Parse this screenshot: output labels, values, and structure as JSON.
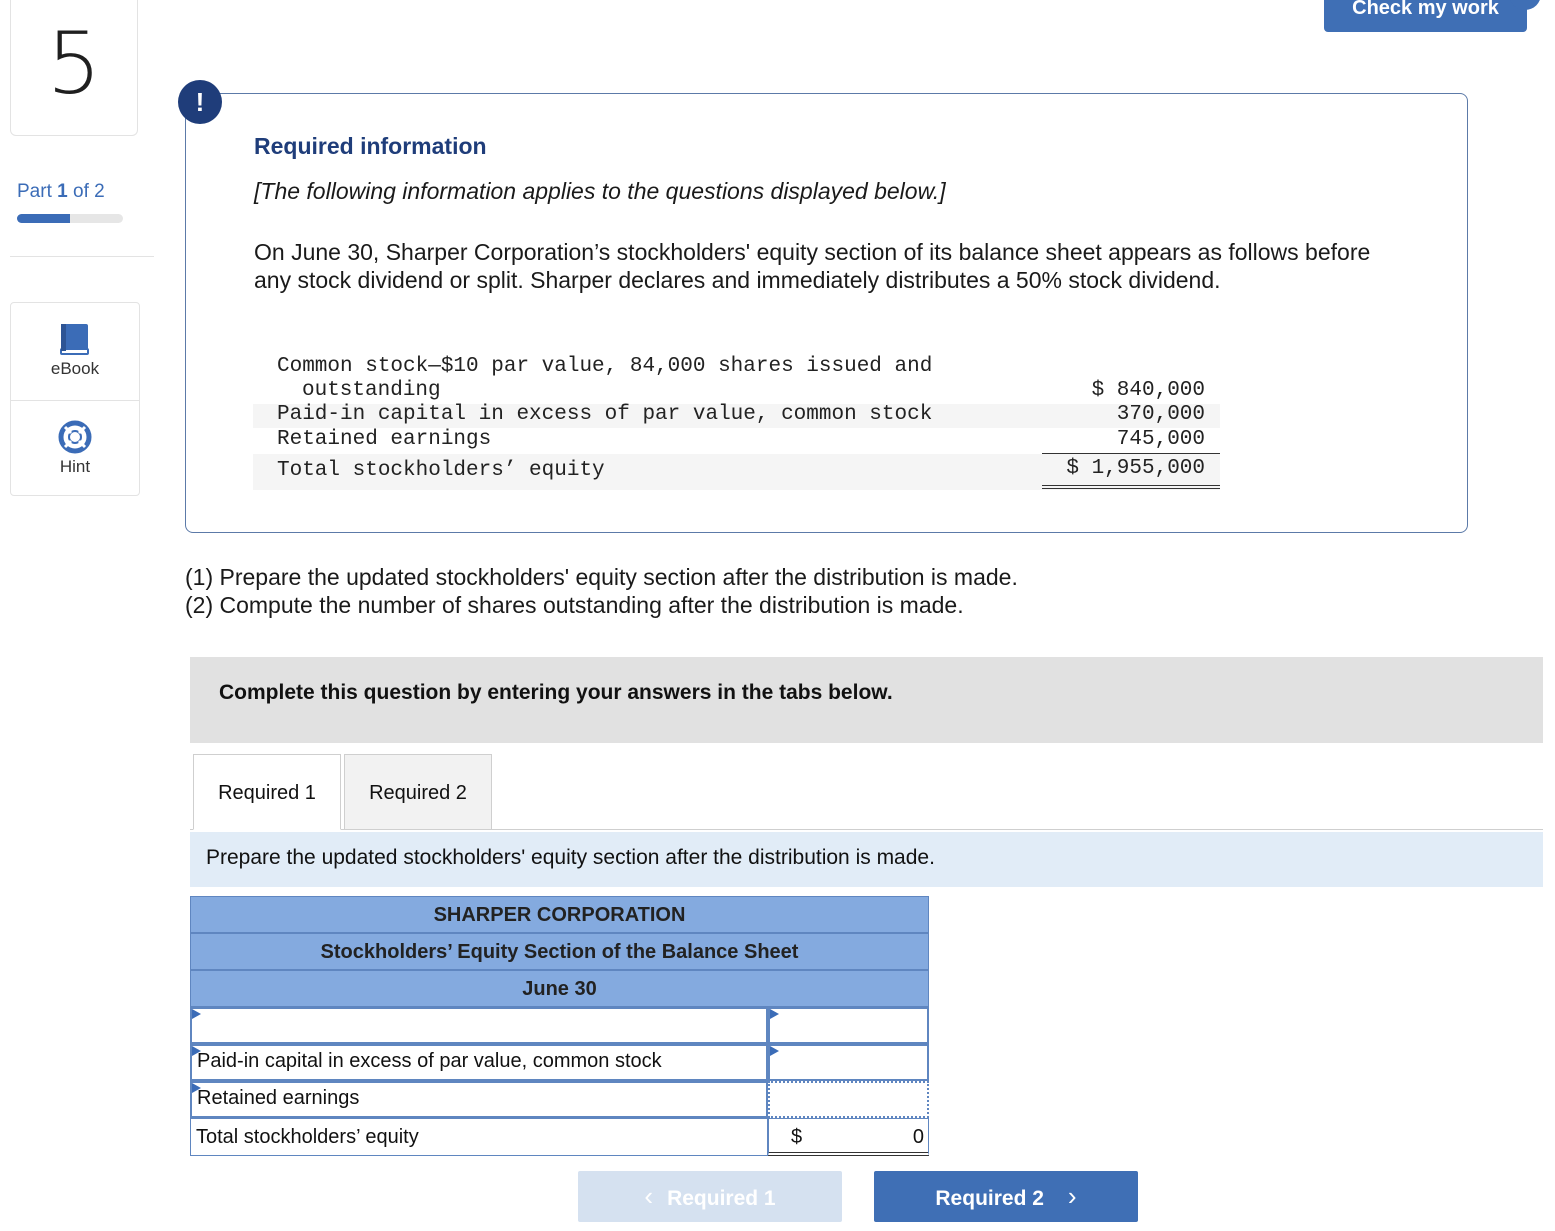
{
  "question": {
    "number": "5"
  },
  "part": {
    "prefix": "Part",
    "current": "1",
    "of_text": "of 2",
    "progress": 0.5
  },
  "tools": {
    "ebook_label": "eBook",
    "hint_label": "Hint"
  },
  "header": {
    "check_my_work": "Check my work"
  },
  "info": {
    "badge": "!",
    "title": "Required information",
    "subtitle": "[The following information applies to the questions displayed below.]",
    "intro": "On June 30, Sharper Corporation’s stockholders' equity section of its balance sheet appears as follows before any stock dividend or split. Sharper declares and immediately distributes a 50% stock dividend.",
    "given": {
      "line1a": "Common stock—$10 par value, 84,000 shares issued and",
      "line1b": "outstanding",
      "line1_amt": "$ 840,000",
      "line2": "Paid-in capital in excess of par value, common stock",
      "line2_amt": "370,000",
      "line3": "Retained earnings",
      "line3_amt": "745,000",
      "total": "Total stockholders’ equity",
      "total_amt": "$ 1,955,000"
    }
  },
  "tasks": {
    "t1": "(1) Prepare the updated stockholders' equity section after the distribution is made.",
    "t2": "(2) Compute the number of shares outstanding after the distribution is made."
  },
  "complete_instruction": "Complete this question by entering your answers in the tabs below.",
  "tabs": [
    {
      "label": "Required 1"
    },
    {
      "label": "Required 2"
    }
  ],
  "tab_instruction": "Prepare the updated stockholders' equity section after the distribution is made.",
  "worksheet": {
    "company": "SHARPER CORPORATION",
    "title": "Stockholders’ Equity Section of the Balance Sheet",
    "date": "June 30",
    "row1_label": "",
    "row1_amount": "",
    "row2_label": "Paid-in capital in excess of par value, common stock",
    "row2_amount": "",
    "row3_label": "Retained earnings",
    "row3_amount": "",
    "total_label": "Total stockholders’ equity",
    "total_currency": "$",
    "total_amount": "0"
  },
  "nav": {
    "prev_label": "Required 1",
    "next_label": "Required 2",
    "prev_arrow": "‹",
    "next_arrow": "›"
  }
}
